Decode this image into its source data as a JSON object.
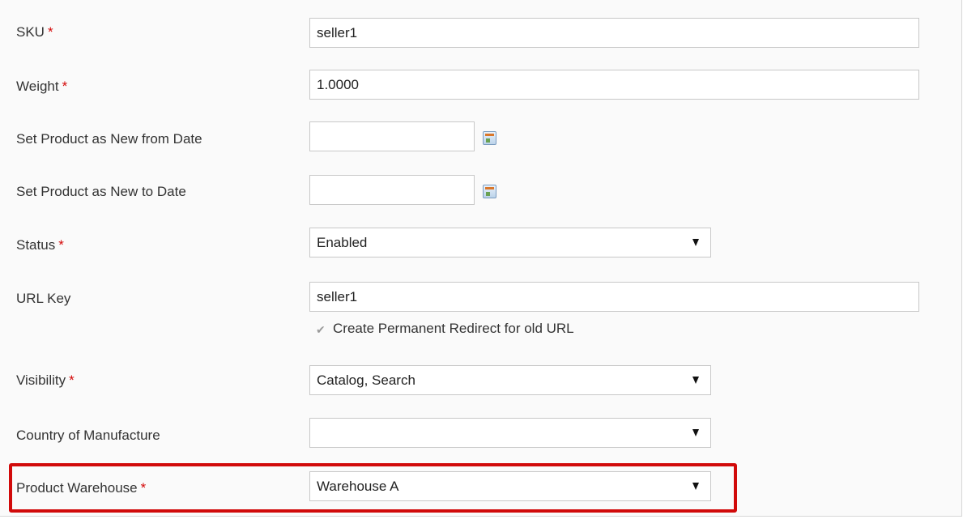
{
  "form": {
    "sku": {
      "label": "SKU",
      "required_mark": "*",
      "value": "seller1"
    },
    "weight": {
      "label": "Weight",
      "required_mark": "*",
      "value": "1.0000"
    },
    "new_from": {
      "label": "Set Product as New from Date",
      "value": "",
      "icon": "calendar-icon"
    },
    "new_to": {
      "label": "Set Product as New to Date",
      "value": "",
      "icon": "calendar-icon"
    },
    "status": {
      "label": "Status",
      "required_mark": "*",
      "selected": "Enabled"
    },
    "url_key": {
      "label": "URL Key",
      "value": "seller1",
      "redirect_label": "Create Permanent Redirect for old URL",
      "redirect_checked": true
    },
    "visibility": {
      "label": "Visibility",
      "required_mark": "*",
      "selected": "Catalog, Search"
    },
    "country": {
      "label": "Country of Manufacture",
      "selected": ""
    },
    "warehouse": {
      "label": "Product Warehouse",
      "required_mark": "*",
      "selected": "Warehouse A"
    }
  },
  "colors": {
    "required": "#d40707",
    "highlight": "#d10a0a"
  }
}
